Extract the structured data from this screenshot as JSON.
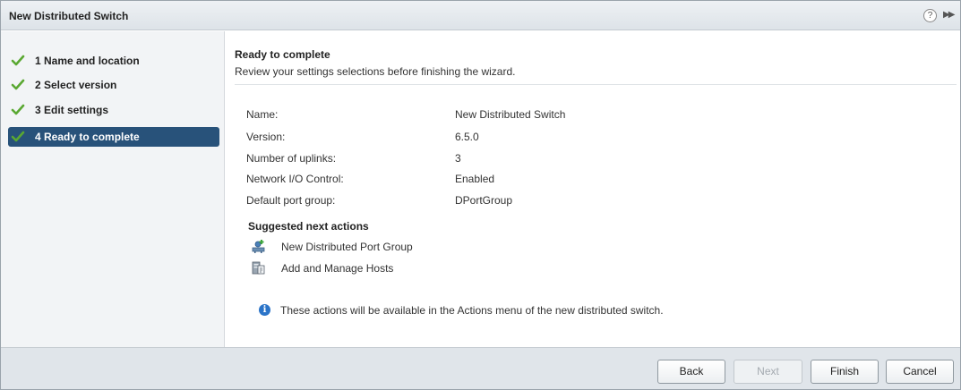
{
  "window": {
    "title": "New Distributed Switch",
    "help_icon": "?",
    "expand_icon": "▶▶"
  },
  "sidebar": {
    "steps": [
      {
        "label": "1  Name and location",
        "state": "done",
        "icon": "check-icon"
      },
      {
        "label": "2  Select version",
        "state": "done",
        "icon": "check-icon"
      },
      {
        "label": "3  Edit settings",
        "state": "done",
        "icon": "check-icon"
      },
      {
        "label": "4  Ready to complete",
        "state": "active",
        "icon": "check-icon"
      }
    ],
    "check_color": "#5aa832",
    "active_color": "#28527a"
  },
  "main": {
    "title": "Ready to complete",
    "subtitle": "Review your settings selections before finishing the wizard.",
    "summary": [
      {
        "key": "Name:",
        "value": "New Distributed Switch"
      },
      {
        "key": "Version:",
        "value": "6.5.0"
      },
      {
        "key": "Number of uplinks:",
        "value": "3"
      },
      {
        "key": "Network I/O Control:",
        "value": "Enabled"
      },
      {
        "key": "Default port group:",
        "value": "DPortGroup"
      }
    ],
    "next_actions": {
      "title": "Suggested next actions",
      "items": [
        {
          "label": "New Distributed Port Group",
          "icon": "port-group-icon"
        },
        {
          "label": "Add and Manage Hosts",
          "icon": "hosts-icon"
        }
      ]
    },
    "info": {
      "icon": "info-icon",
      "text": "These actions will be available in the Actions menu of the new distributed switch."
    }
  },
  "footer": {
    "back": "Back",
    "next": "Next",
    "finish": "Finish",
    "cancel": "Cancel"
  }
}
